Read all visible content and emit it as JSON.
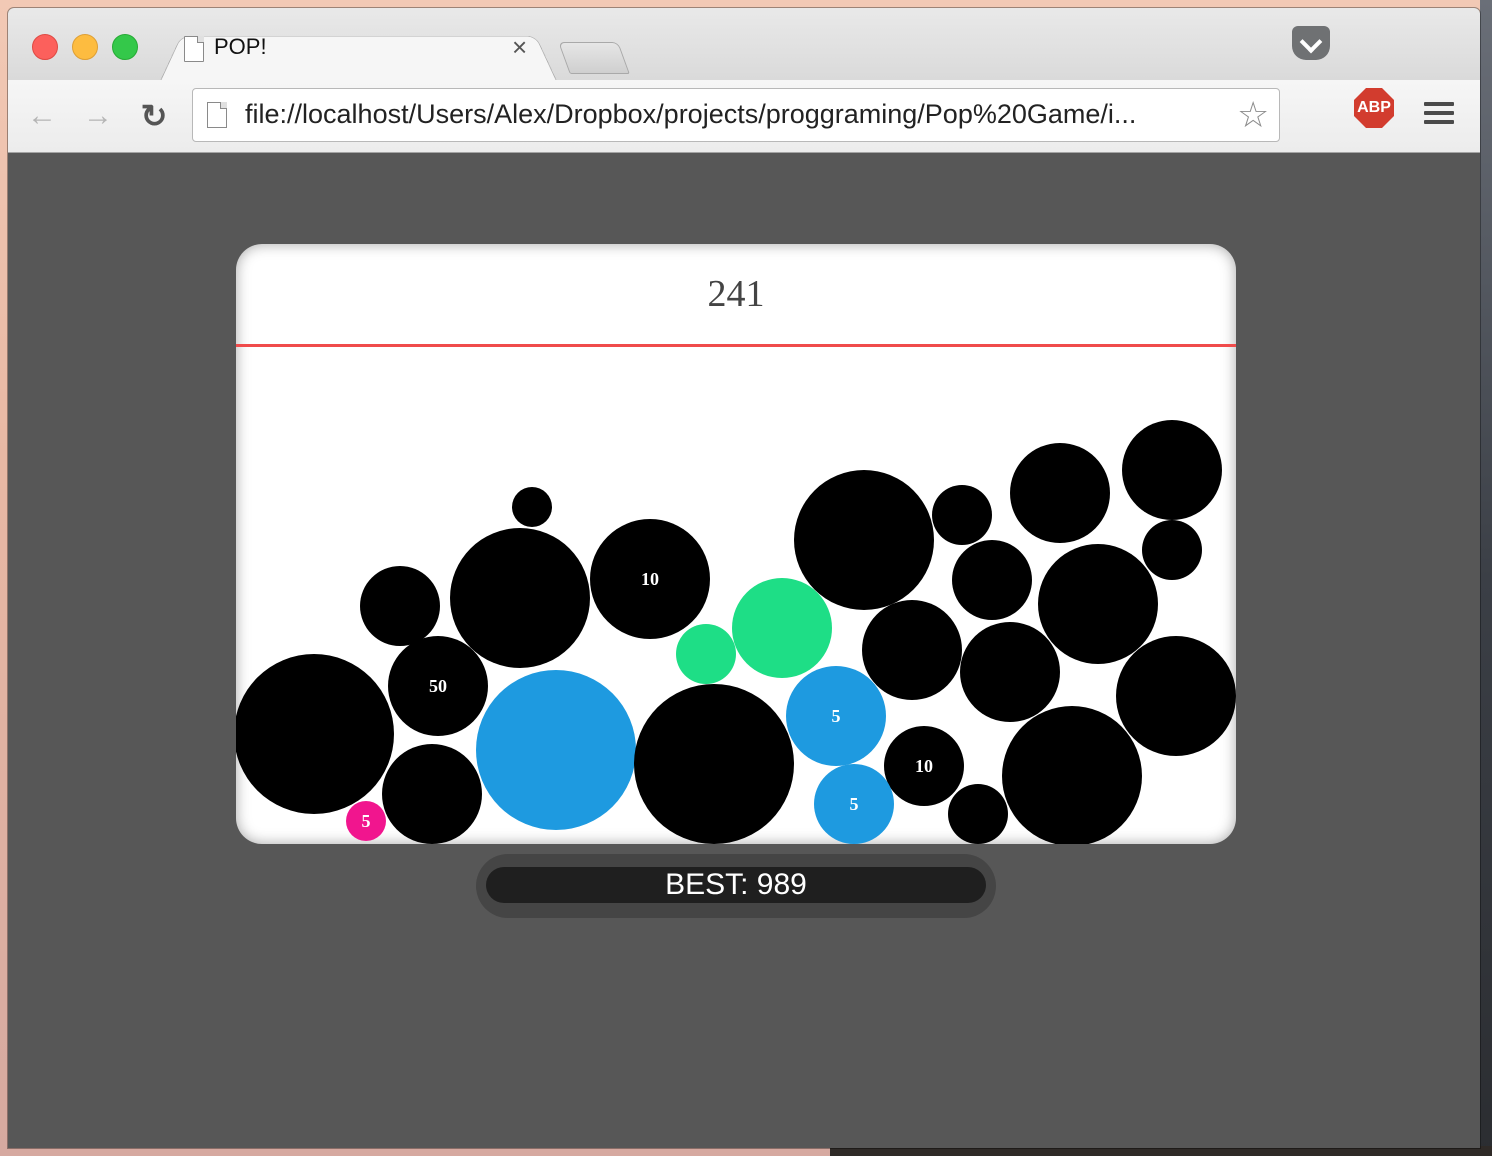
{
  "browser": {
    "tab_title": "POP!",
    "tab_close": "×",
    "url": "file://localhost/Users/Alex/Dropbox/projects/proggraming/Pop%20Game/i...",
    "extensions": {
      "abp_label": "ABP"
    }
  },
  "game": {
    "score": "241",
    "best": "BEST: 989",
    "colors": {
      "black": "#000000",
      "blue": "#1e9ae0",
      "green": "#1ede86",
      "pink": "#f1158e",
      "danger_line": "#f04b4b",
      "page_bg": "#575757"
    },
    "bubbles": [
      {
        "color": "black",
        "label": ""
      },
      {
        "color": "black",
        "label": ""
      },
      {
        "color": "black",
        "label": ""
      },
      {
        "color": "black",
        "label": "10"
      },
      {
        "color": "black",
        "label": ""
      },
      {
        "color": "black",
        "label": ""
      },
      {
        "color": "black",
        "label": ""
      },
      {
        "color": "black",
        "label": ""
      },
      {
        "color": "black",
        "label": ""
      },
      {
        "color": "black",
        "label": ""
      },
      {
        "color": "black",
        "label": "50"
      },
      {
        "color": "green",
        "label": ""
      },
      {
        "color": "green",
        "label": ""
      },
      {
        "color": "black",
        "label": ""
      },
      {
        "color": "black",
        "label": ""
      },
      {
        "color": "black",
        "label": ""
      },
      {
        "color": "black",
        "label": ""
      },
      {
        "color": "black",
        "label": ""
      },
      {
        "color": "blue",
        "label": ""
      },
      {
        "color": "black",
        "label": ""
      },
      {
        "color": "blue",
        "label": "5"
      },
      {
        "color": "black",
        "label": ""
      },
      {
        "color": "black",
        "label": ""
      },
      {
        "color": "black",
        "label": ""
      },
      {
        "color": "black",
        "label": "10"
      },
      {
        "color": "blue",
        "label": "5"
      },
      {
        "color": "black",
        "label": ""
      },
      {
        "color": "pink",
        "label": "5"
      }
    ]
  }
}
